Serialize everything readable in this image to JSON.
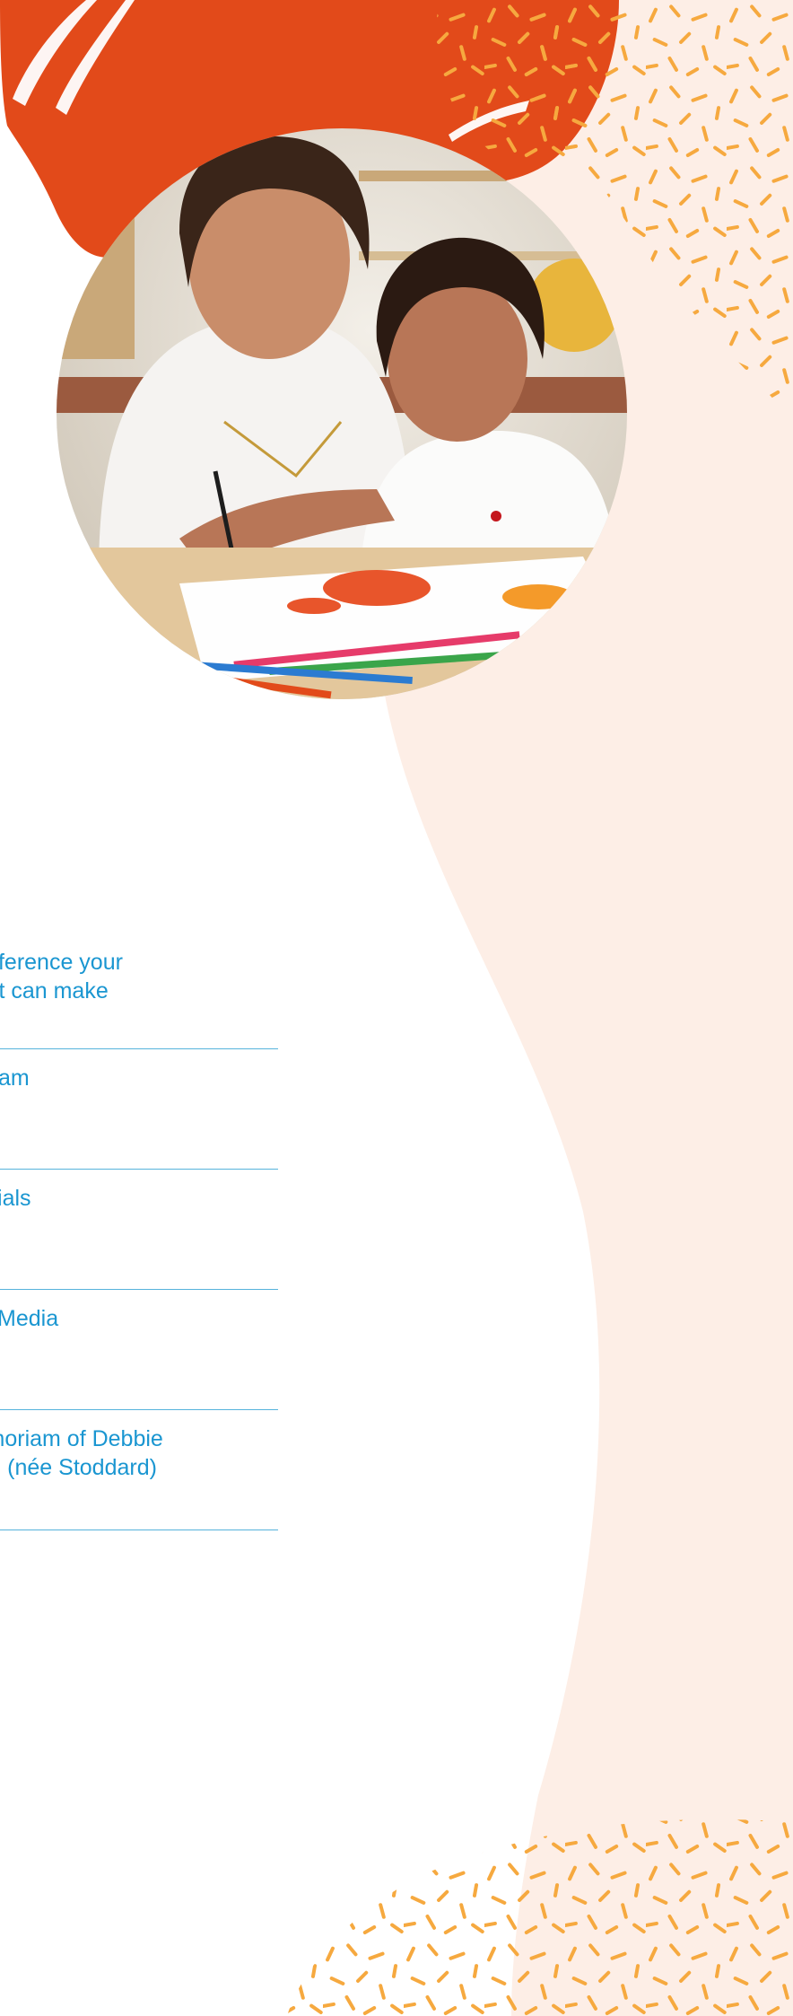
{
  "toc": {
    "items": [
      {
        "line1": "The difference your",
        "line2": "support can make"
      },
      {
        "line1": "The Team",
        "line2": ""
      },
      {
        "line1": "Financials",
        "line2": ""
      },
      {
        "line1": "Social Media",
        "line2": ""
      },
      {
        "line1": "In memoriam of Debbie",
        "line2": "Gibson (née Stoddard)"
      }
    ]
  },
  "colors": {
    "orange_red": "#e24a1a",
    "peach_bg": "#fdeee6",
    "speckle": "#f6a93f",
    "link_blue": "#1a96d1",
    "rule_blue": "#56b3dc"
  },
  "images": {
    "hero_photo": "mother-and-daughter-painting-photo"
  }
}
